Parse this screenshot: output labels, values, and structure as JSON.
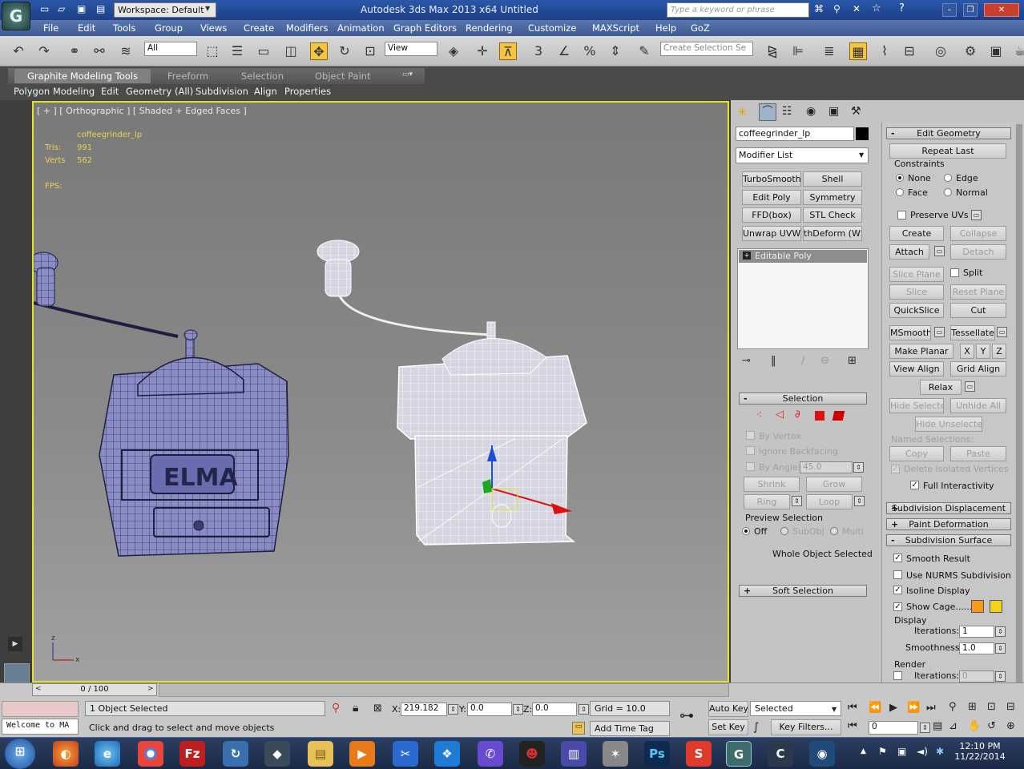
{
  "titlebar": {
    "workspace": "Workspace: Default",
    "title": "Autodesk 3ds Max  2013 x64      Untitled",
    "search_placeholder": "Type a keyword or phrase"
  },
  "menu": [
    "File",
    "Edit",
    "Tools",
    "Group",
    "Views",
    "Create",
    "Modifiers",
    "Animation",
    "Graph Editors",
    "Rendering",
    "Customize",
    "MAXScript",
    "Help",
    "GoZ"
  ],
  "toolbar": {
    "filter": "All",
    "ref_coord": "View",
    "selection_set": "Create Selection Se",
    "snap_3": "3"
  },
  "ribbon": {
    "tabs": [
      "Graphite Modeling Tools",
      "Freeform",
      "Selection",
      "Object Paint"
    ],
    "sub": [
      "Polygon Modeling",
      "Edit",
      "Geometry (All)",
      "Subdivision",
      "Align",
      "Properties"
    ]
  },
  "viewport": {
    "label": "[ + ] [ Orthographic ] [ Shaded + Edged Faces ]",
    "object": "coffeegrinder_lp",
    "tris_label": "Tris:",
    "tris": "991",
    "verts_label": "Verts",
    "verts": "562",
    "fps_label": "FPS:",
    "brand": "ELMA",
    "axis_z": "z",
    "axis_x": "x"
  },
  "panel": {
    "name": "coffeegrinder_lp",
    "modifier_list": "Modifier List",
    "mod_buttons": [
      "TurboSmooth",
      "Shell",
      "Edit Poly",
      "Symmetry",
      "FFD(box)",
      "STL Check",
      "Unwrap UVW",
      "thDeform (WSI"
    ],
    "stack_item": "Editable Poly",
    "selection": {
      "title": "Selection",
      "by_vertex": "By Vertex",
      "ignore_backfacing": "Ignore Backfacing",
      "by_angle": "By Angle:",
      "angle": "45.0",
      "shrink": "Shrink",
      "grow": "Grow",
      "ring": "Ring",
      "loop": "Loop",
      "preview": "Preview Selection",
      "off": "Off",
      "subobj": "SubObj",
      "multi": "Multi",
      "status": "Whole Object Selected"
    },
    "soft_selection": "Soft Selection",
    "edit_geometry": {
      "title": "Edit Geometry",
      "repeat_last": "Repeat Last",
      "constraints": "Constraints",
      "none": "None",
      "edge": "Edge",
      "face": "Face",
      "normal": "Normal",
      "preserve_uvs": "Preserve UVs",
      "create": "Create",
      "collapse": "Collapse",
      "attach": "Attach",
      "detach": "Detach",
      "slice_plane": "Slice Plane",
      "split": "Split",
      "slice": "Slice",
      "reset_plane": "Reset Plane",
      "quickslice": "QuickSlice",
      "cut": "Cut",
      "msmooth": "MSmooth",
      "tessellate": "Tessellate",
      "make_planar": "Make Planar",
      "x": "X",
      "y": "Y",
      "z": "Z",
      "view_align": "View Align",
      "grid_align": "Grid Align",
      "relax": "Relax",
      "hide_selected": "Hide Selected",
      "unhide_all": "Unhide All",
      "hide_unselected": "Hide Unselected",
      "named_selections": "Named Selections:",
      "copy": "Copy",
      "paste": "Paste",
      "delete_isolated": "Delete Isolated Vertices",
      "full_interactivity": "Full Interactivity"
    },
    "subdiv_displacement": "Subdivision Displacement",
    "paint_deformation": "Paint Deformation",
    "subdivision_surface": {
      "title": "Subdivision Surface",
      "smooth_result": "Smooth Result",
      "use_nurms": "Use NURMS Subdivision",
      "isoline": "Isoline Display",
      "show_cage": "Show Cage......",
      "display": "Display",
      "iterations_label": "Iterations:",
      "iterations": "1",
      "smoothness_label": "Smoothness:",
      "smoothness": "1.0",
      "render": "Render",
      "render_iterations": "0",
      "cage_color_1": "#f59a1c",
      "cage_color_2": "#f3d21e"
    }
  },
  "bottom": {
    "timeline": "0 / 100",
    "selected": "1 Object Selected",
    "prompt": "Click and drag to select and move objects",
    "listener": "Welcome to MA",
    "x_label": "X:",
    "x": "219.182",
    "y_label": "Y:",
    "y": "0.0",
    "z_label": "Z:",
    "z": "0.0",
    "grid": "Grid = 10.0",
    "add_time_tag": "Add Time Tag",
    "auto_key": "Auto Key",
    "set_key": "Set Key",
    "key_mode": "Selected",
    "key_filters": "Key Filters...",
    "frame": "0"
  },
  "taskbar": {
    "time": "12:10 PM",
    "date": "11/22/2014"
  }
}
